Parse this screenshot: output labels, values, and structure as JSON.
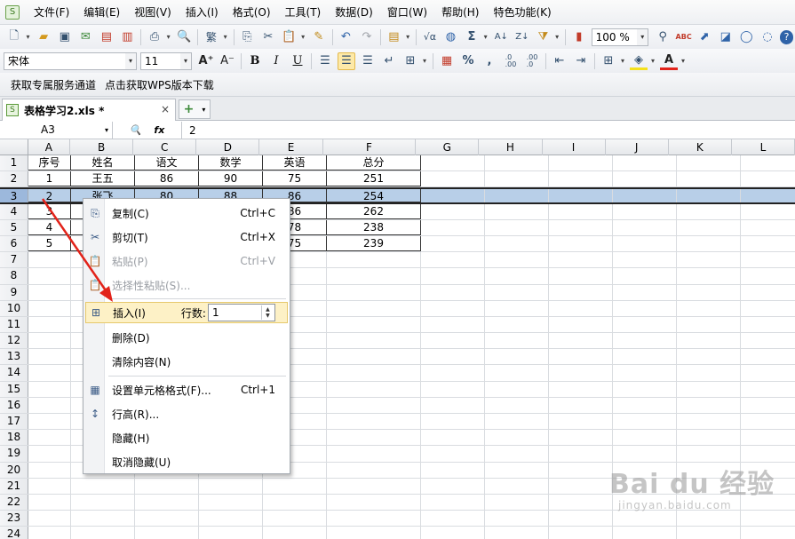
{
  "menubar": {
    "items": [
      "文件(F)",
      "编辑(E)",
      "视图(V)",
      "插入(I)",
      "格式(O)",
      "工具(T)",
      "数据(D)",
      "窗口(W)",
      "帮助(H)",
      "特色功能(K)"
    ]
  },
  "toolbar1": {
    "zoom": "100 %"
  },
  "toolbar2": {
    "font_name": "宋体",
    "font_size": "11",
    "bold": "B",
    "italic": "I",
    "underline": "U",
    "percent": "%",
    "comma": ",",
    "increase_decimal": ".0\n.00",
    "decrease_decimal": ".00\n.0"
  },
  "promo": {
    "link1": "获取专属服务通道",
    "link2": "点击获取WPS版本下载"
  },
  "tabs": {
    "doc_title": "表格学习2.xls *",
    "close": "×",
    "new": "+"
  },
  "formula_bar": {
    "name_box": "A3",
    "fx": "fx",
    "value": "2"
  },
  "columns": [
    "A",
    "B",
    "C",
    "D",
    "E",
    "F",
    "G",
    "H",
    "I",
    "J",
    "K",
    "L"
  ],
  "row_numbers": [
    "1",
    "2",
    "3",
    "4",
    "5",
    "6",
    "7",
    "8",
    "9",
    "10",
    "11",
    "12",
    "13",
    "14",
    "15",
    "16",
    "17",
    "18",
    "19",
    "20",
    "21",
    "22",
    "23",
    "24"
  ],
  "table": [
    [
      "序号",
      "姓名",
      "语文",
      "数学",
      "英语",
      "总分"
    ],
    [
      "1",
      "王五",
      "86",
      "90",
      "75",
      "251"
    ],
    [
      "2",
      "张飞",
      "80",
      "88",
      "86",
      "254"
    ],
    [
      "3",
      "",
      "",
      "",
      "86",
      "262"
    ],
    [
      "4",
      "",
      "",
      "",
      "78",
      "238"
    ],
    [
      "5",
      "",
      "",
      "",
      "75",
      "239"
    ]
  ],
  "context_menu": {
    "copy": {
      "label": "复制(C)",
      "key": "Ctrl+C"
    },
    "cut": {
      "label": "剪切(T)",
      "key": "Ctrl+X"
    },
    "paste": {
      "label": "粘贴(P)",
      "key": "Ctrl+V"
    },
    "paste_special": {
      "label": "选择性粘贴(S)..."
    },
    "insert": {
      "label": "插入(I)",
      "rows_label": "行数:",
      "rows_value": "1"
    },
    "delete": {
      "label": "删除(D)"
    },
    "clear": {
      "label": "清除内容(N)"
    },
    "format_cells": {
      "label": "设置单元格格式(F)...",
      "key": "Ctrl+1"
    },
    "row_height": {
      "label": "行高(R)..."
    },
    "hide": {
      "label": "隐藏(H)"
    },
    "unhide": {
      "label": "取消隐藏(U)"
    }
  },
  "watermark": {
    "main": "Bai du 经验",
    "sub": "jingyan.baidu.com"
  },
  "colors": {
    "selection": "#b8cfe8",
    "menu_hover": "#fdf1c6",
    "arrow": "#e2231a"
  }
}
